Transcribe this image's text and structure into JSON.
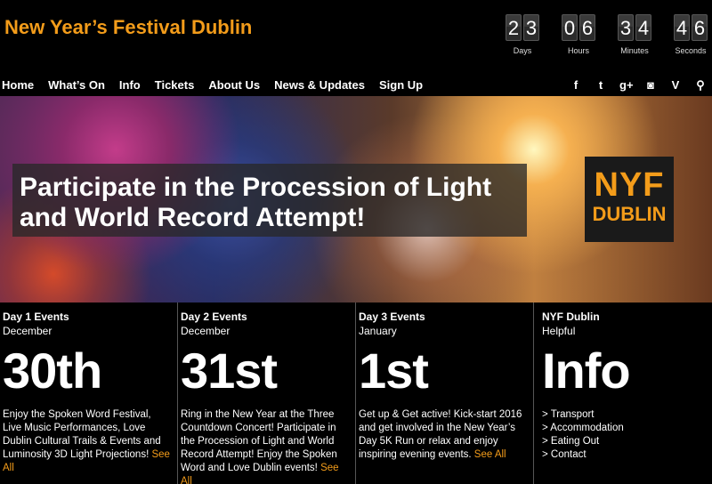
{
  "header": {
    "site_title": "New Year’s Festival Dublin",
    "countdown": [
      {
        "digits": [
          "2",
          "3"
        ],
        "label": "Days"
      },
      {
        "digits": [
          "0",
          "6"
        ],
        "label": "Hours"
      },
      {
        "digits": [
          "3",
          "4"
        ],
        "label": "Minutes"
      },
      {
        "digits": [
          "4",
          "6"
        ],
        "label": "Seconds"
      }
    ]
  },
  "nav": {
    "items": [
      "Home",
      "What’s On",
      "Info",
      "Tickets",
      "About Us",
      "News & Updates",
      "Sign Up"
    ],
    "social_icons": [
      {
        "name": "facebook-icon",
        "glyph": "f"
      },
      {
        "name": "twitter-icon",
        "glyph": "t"
      },
      {
        "name": "googleplus-icon",
        "glyph": "g+"
      },
      {
        "name": "instagram-icon",
        "glyph": "◙"
      },
      {
        "name": "vine-icon",
        "glyph": "V"
      },
      {
        "name": "search-icon",
        "glyph": "⚲"
      }
    ]
  },
  "hero": {
    "title": "Participate in the Procession of Light and World Record Attempt!",
    "logo_line1": "NYF",
    "logo_line2": "DUBLIN"
  },
  "columns": [
    {
      "heading": "Day 1 Events",
      "sub": "December",
      "big": "30th",
      "text": "Enjoy the Spoken Word Festival, Live Music Performances, Love Dublin Cultural Trails & Events and Luminosity 3D Light Projections!",
      "link": "See All"
    },
    {
      "heading": "Day 2 Events",
      "sub": "December",
      "big": "31st",
      "text": "Ring in the New Year at the Three Countdown Concert! Participate in the Procession of Light and World Record Attempt! Enjoy the Spoken Word and Love Dublin events!",
      "link": "See All"
    },
    {
      "heading": "Day 3 Events",
      "sub": "January",
      "big": "1st",
      "text": "Get up & Get active! Kick-start 2016 and get involved in the New Year’s Day 5K Run or relax and enjoy inspiring evening events.",
      "link": "See All"
    },
    {
      "heading": "NYF Dublin",
      "sub": "Helpful",
      "big": "Info",
      "links": [
        "> Transport",
        "> Accommodation",
        "> Eating Out",
        "> Contact"
      ]
    }
  ],
  "colors": {
    "accent": "#f39c1a",
    "background": "#000000"
  }
}
